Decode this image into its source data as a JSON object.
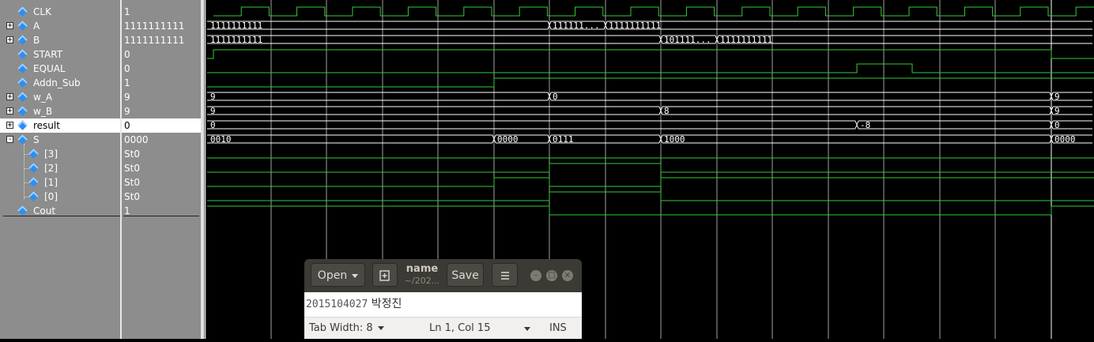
{
  "signals": [
    {
      "name": "CLK",
      "value": "1",
      "expander": "",
      "indent": 0
    },
    {
      "name": "A",
      "value": "1111111111",
      "expander": "+",
      "indent": 0
    },
    {
      "name": "B",
      "value": "1111111111",
      "expander": "+",
      "indent": 0
    },
    {
      "name": "START",
      "value": "0",
      "expander": "",
      "indent": 0
    },
    {
      "name": "EQUAL",
      "value": "0",
      "expander": "",
      "indent": 0
    },
    {
      "name": "Addn_Sub",
      "value": "1",
      "expander": "",
      "indent": 0
    },
    {
      "name": "w_A",
      "value": "9",
      "expander": "+",
      "indent": 0
    },
    {
      "name": "w_B",
      "value": "9",
      "expander": "+",
      "indent": 0
    },
    {
      "name": "result",
      "value": "0",
      "expander": "+",
      "indent": 0,
      "selected": true
    },
    {
      "name": "S",
      "value": "0000",
      "expander": "-",
      "indent": 0
    },
    {
      "name": "[3]",
      "value": "St0",
      "expander": "",
      "indent": 1
    },
    {
      "name": "[2]",
      "value": "St0",
      "expander": "",
      "indent": 1
    },
    {
      "name": "[1]",
      "value": "St0",
      "expander": "",
      "indent": 1
    },
    {
      "name": "[0]",
      "value": "St0",
      "expander": "",
      "indent": 1
    },
    {
      "name": "Cout",
      "value": "1",
      "expander": "",
      "indent": 0
    }
  ],
  "wave_labels": {
    "A": [
      "1111111111",
      "111111...",
      "1111111111"
    ],
    "B": [
      "1111111111",
      "101111...",
      "1111111111"
    ],
    "w_A": [
      "9",
      "0",
      "9"
    ],
    "w_B": [
      "9",
      "8",
      "9"
    ],
    "result": [
      "0",
      "-8",
      "0"
    ],
    "S": [
      "0010",
      "0000",
      "0111",
      "1000",
      "0000"
    ]
  },
  "colors": {
    "wave": "#33cc33",
    "grid": "#ffffff",
    "panel": "#8d8d8d"
  },
  "gedit": {
    "open_label": "Open",
    "title": "name",
    "subtitle": "~/202...",
    "save_label": "Save",
    "menu_icon": "hamburger-icon",
    "doc_number": "2015104027",
    "doc_name": "박정진",
    "tab_width": "Tab Width: 8",
    "position": "Ln 1, Col 15",
    "mode": "INS"
  }
}
